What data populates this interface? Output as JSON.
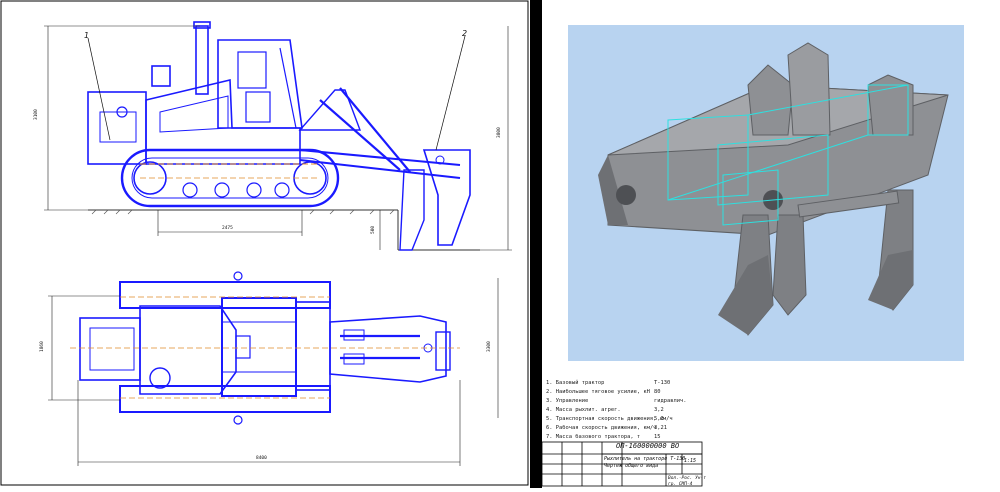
{
  "drawing": {
    "callouts": [
      "1",
      "2"
    ],
    "dims_side": {
      "height_left": "3100",
      "height_right": "3800",
      "track_base": "2475",
      "depth": "500"
    },
    "dims_top": {
      "width_left": "1860",
      "width_right": "3300",
      "overall_length": "8400"
    }
  },
  "specs": {
    "rows": [
      {
        "label": "1. Базовый трактор",
        "value": "Т-130"
      },
      {
        "label": "2. Наибольшее тяговое усилие, кН",
        "value": "80"
      },
      {
        "label": "3. Управление",
        "value": "гидравлич."
      },
      {
        "label": "4. Масса рыхлит. агрег.",
        "value": "3,2"
      },
      {
        "label": "5. Транспортная скорость движения, км/ч",
        "value": "5,3"
      },
      {
        "label": "6. Рабочая скорость движения, км/ч",
        "value": "3,21"
      },
      {
        "label": "7. Масса базового трактора, т",
        "value": "15"
      }
    ]
  },
  "title_block": {
    "code": "ОП-160000000 ВО",
    "name_line1": "Рыхлитель на тракторе Т-130",
    "name_line2": "Чертеж общего вида",
    "sheet": "1:15",
    "org_line1": "Вол.-Рос. Ун-т",
    "org_line2": "гр. СМП-4"
  },
  "colors": {
    "drawing_line": "#1a1aff",
    "accent_line": "#e08a2a",
    "model_fill": "#8e9094",
    "wire": "#2de0e0",
    "background_render": "#b8d3f0"
  }
}
